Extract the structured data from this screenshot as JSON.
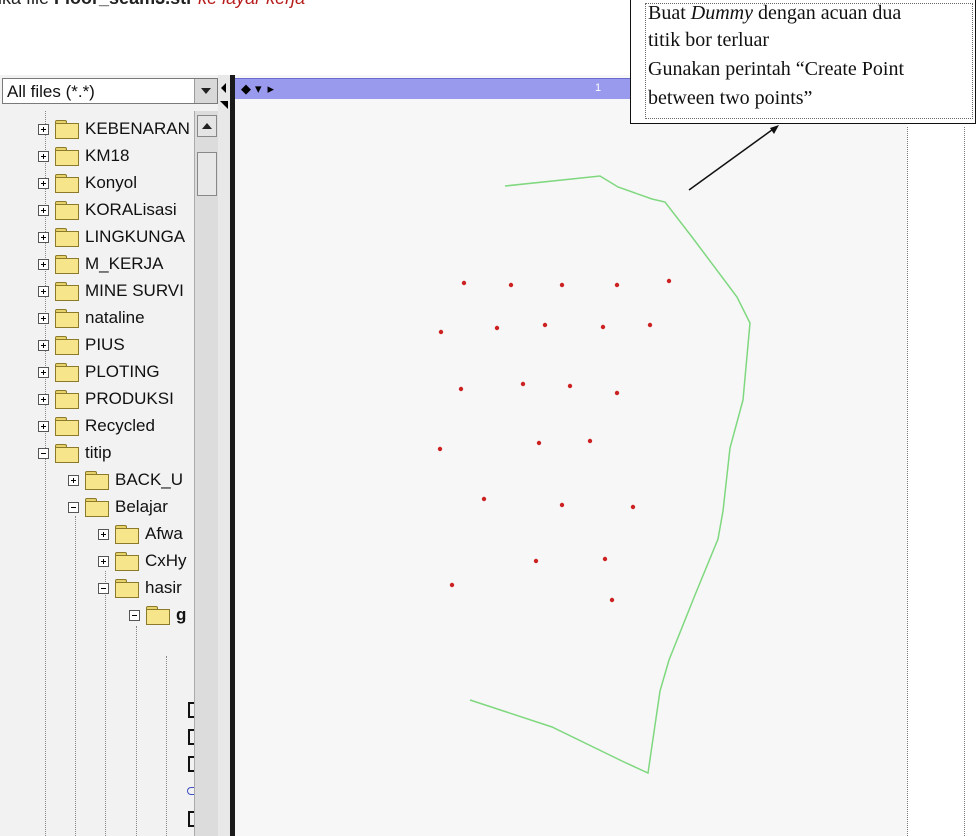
{
  "document": {
    "top_line_prefix": "Buka file ",
    "top_line_filename": "Floor_seam3.str",
    "top_line_suffix": " ke layar kerja"
  },
  "file_panel": {
    "filter_value": "All files (*.*)",
    "tree": [
      {
        "label": "KEBENARAN",
        "level": 0
      },
      {
        "label": "KM18",
        "level": 0
      },
      {
        "label": "Konyol",
        "level": 0
      },
      {
        "label": "KORALisasi",
        "level": 0
      },
      {
        "label": "LINGKUNGA",
        "level": 0
      },
      {
        "label": "M_KERJA",
        "level": 0
      },
      {
        "label": "MINE SURVI",
        "level": 0
      },
      {
        "label": "nataline",
        "level": 0
      },
      {
        "label": "PIUS",
        "level": 0
      },
      {
        "label": "PLOTING",
        "level": 0
      },
      {
        "label": "PRODUKSI",
        "level": 0
      },
      {
        "label": "Recycled",
        "level": 0
      },
      {
        "label": "titip",
        "level": 0,
        "expanded": true
      },
      {
        "label": "BACK_U",
        "level": 1
      },
      {
        "label": "Belajar",
        "level": 1,
        "expanded": true
      },
      {
        "label": "Afwa",
        "level": 2
      },
      {
        "label": "CxHy",
        "level": 2
      },
      {
        "label": "hasir",
        "level": 2,
        "expanded": true
      },
      {
        "label": "g",
        "level": 3,
        "expanded": true
      }
    ]
  },
  "viewport": {
    "tab_number": "1",
    "boundary_color": "#7fd87f",
    "point_color": "#cc2222"
  },
  "callout": {
    "line1_prefix": "Buat ",
    "line1_italic": "Dummy",
    "line1_suffix": " dengan acuan dua",
    "line2": "titik bor terluar",
    "line3": "Gunakan perintah “Create Point",
    "line4": "between two points”"
  }
}
